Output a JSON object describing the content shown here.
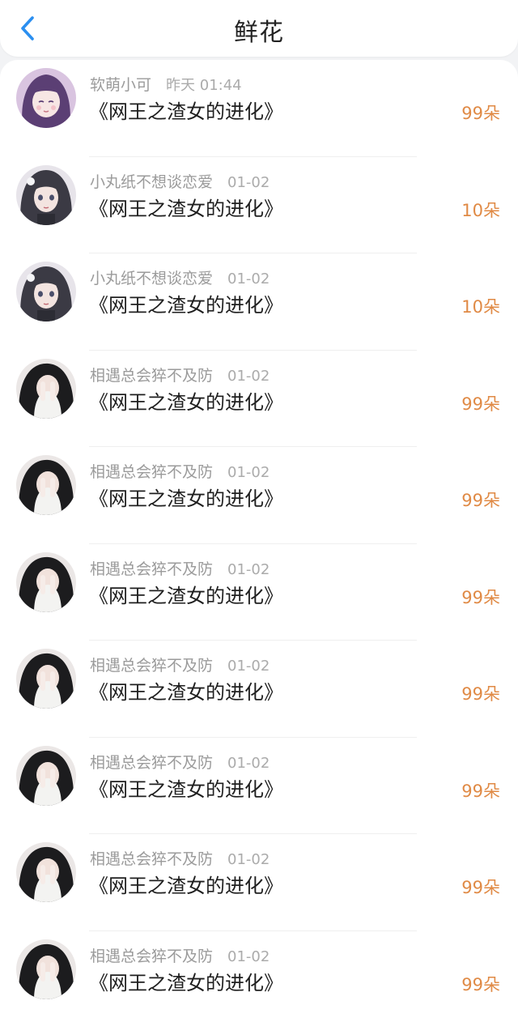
{
  "header": {
    "title": "鲜花",
    "back_icon": "chevron-left-icon"
  },
  "colors": {
    "accent_blue": "#2b8ff0",
    "amount_orange": "#e08a45",
    "meta_gray": "#9b9b9b",
    "title_text": "#1f1f1f"
  },
  "rows": [
    {
      "user": "软萌小可",
      "time": "昨天 01:44",
      "book": "《网王之渣女的进化》",
      "amount": "99朵",
      "avatar": "avatar-purple-anime-girl"
    },
    {
      "user": "小丸纸不想谈恋爱",
      "time": "01-02",
      "book": "《网王之渣女的进化》",
      "amount": "10朵",
      "avatar": "avatar-anime-girl"
    },
    {
      "user": "小丸纸不想谈恋爱",
      "time": "01-02",
      "book": "《网王之渣女的进化》",
      "amount": "10朵",
      "avatar": "avatar-anime-girl"
    },
    {
      "user": "相遇总会猝不及防",
      "time": "01-02",
      "book": "《网王之渣女的进化》",
      "amount": "99朵",
      "avatar": "avatar-hands-face-girl"
    },
    {
      "user": "相遇总会猝不及防",
      "time": "01-02",
      "book": "《网王之渣女的进化》",
      "amount": "99朵",
      "avatar": "avatar-hands-face-girl"
    },
    {
      "user": "相遇总会猝不及防",
      "time": "01-02",
      "book": "《网王之渣女的进化》",
      "amount": "99朵",
      "avatar": "avatar-hands-face-girl"
    },
    {
      "user": "相遇总会猝不及防",
      "time": "01-02",
      "book": "《网王之渣女的进化》",
      "amount": "99朵",
      "avatar": "avatar-hands-face-girl"
    },
    {
      "user": "相遇总会猝不及防",
      "time": "01-02",
      "book": "《网王之渣女的进化》",
      "amount": "99朵",
      "avatar": "avatar-hands-face-girl"
    },
    {
      "user": "相遇总会猝不及防",
      "time": "01-02",
      "book": "《网王之渣女的进化》",
      "amount": "99朵",
      "avatar": "avatar-hands-face-girl"
    },
    {
      "user": "相遇总会猝不及防",
      "time": "01-02",
      "book": "《网王之渣女的进化》",
      "amount": "99朵",
      "avatar": "avatar-hands-face-girl"
    }
  ]
}
